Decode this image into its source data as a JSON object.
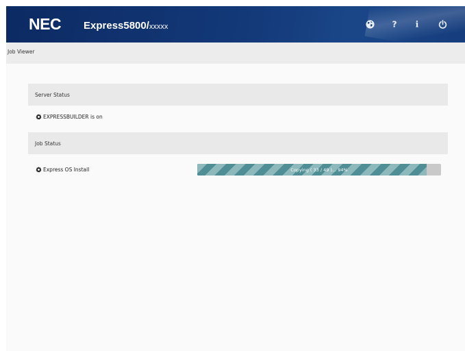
{
  "header": {
    "logo": "NEC",
    "product": "Express5800/",
    "model": "xxxxx",
    "icons": [
      "globe-icon",
      "help-icon",
      "info-icon",
      "power-icon"
    ]
  },
  "subbar": {
    "title": "Job Viewer"
  },
  "server_status": {
    "heading": "Server Status",
    "item": "EXPRESSBUILDER is on"
  },
  "job_status": {
    "heading": "Job Status",
    "item": "Express OS Install",
    "progress_text": "Copying ( 33 / 49 )... 94%",
    "progress_fraction": 0.94
  },
  "colors": {
    "header_bg": "#143a7a",
    "progress_fill": "#4f8e95",
    "progress_stripe": "#8db8bc",
    "progress_track": "#c9c9c9"
  }
}
